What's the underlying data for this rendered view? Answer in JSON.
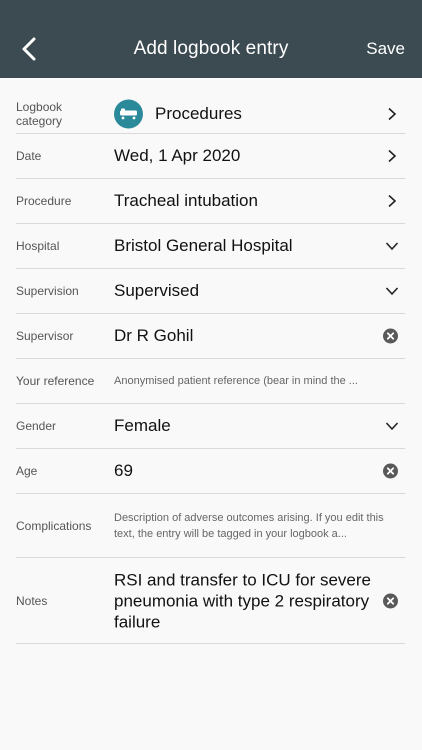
{
  "header": {
    "title": "Add logbook entry",
    "save_label": "Save",
    "accent": "#3c4b52"
  },
  "form": {
    "category": {
      "label": "Logbook category",
      "value": "Procedures",
      "icon": "stretcher-icon",
      "icon_color": "#2b8a9a"
    },
    "date": {
      "label": "Date",
      "value": "Wed, 1 Apr 2020"
    },
    "procedure": {
      "label": "Procedure",
      "value": "Tracheal intubation"
    },
    "hospital": {
      "label": "Hospital",
      "value": "Bristol General Hospital"
    },
    "supervision": {
      "label": "Supervision",
      "value": "Supervised"
    },
    "supervisor": {
      "label": "Supervisor",
      "value": "Dr R Gohil"
    },
    "reference": {
      "label": "Your reference",
      "placeholder": "Anonymised patient reference (bear in mind the ..."
    },
    "gender": {
      "label": "Gender",
      "value": "Female"
    },
    "age": {
      "label": "Age",
      "value": "69"
    },
    "complications": {
      "label": "Complications",
      "placeholder": "Description of adverse outcomes arising. If you edit this text, the entry will be tagged in your logbook a..."
    },
    "notes": {
      "label": "Notes",
      "value": "RSI and transfer to ICU for severe pneumonia with type 2 respiratory failure"
    }
  }
}
